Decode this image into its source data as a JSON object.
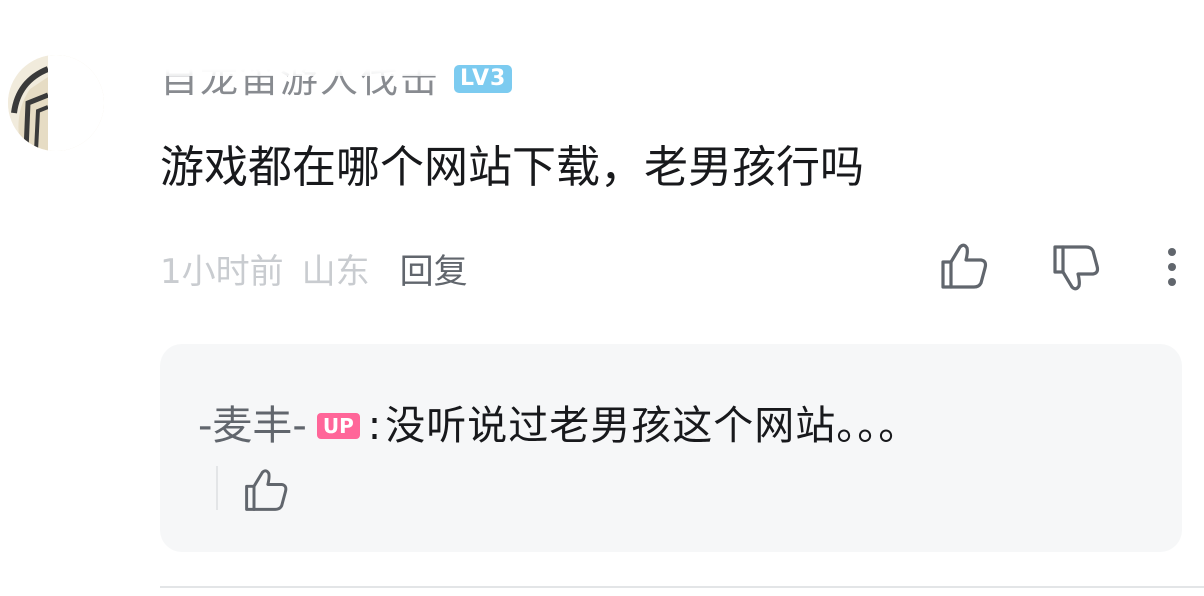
{
  "comment": {
    "username": "自龙笛游人伐击",
    "level_badge": "LV3",
    "text": "游戏都在哪个网站下载，老男孩行吗",
    "time": "1小时前",
    "location": "山东",
    "reply_label": "回复"
  },
  "reply": {
    "username": "-麦丰-",
    "up_badge": "UP",
    "colon": ":",
    "text": "没听说过老男孩这个网站。。。"
  },
  "icons": {
    "like": "thumbs-up-icon",
    "dislike": "thumbs-down-icon",
    "more": "more-vertical-icon"
  },
  "colors": {
    "level_badge": "#7ccbf0",
    "up_badge": "#ff6699",
    "reply_card_bg": "#f6f7f8"
  }
}
